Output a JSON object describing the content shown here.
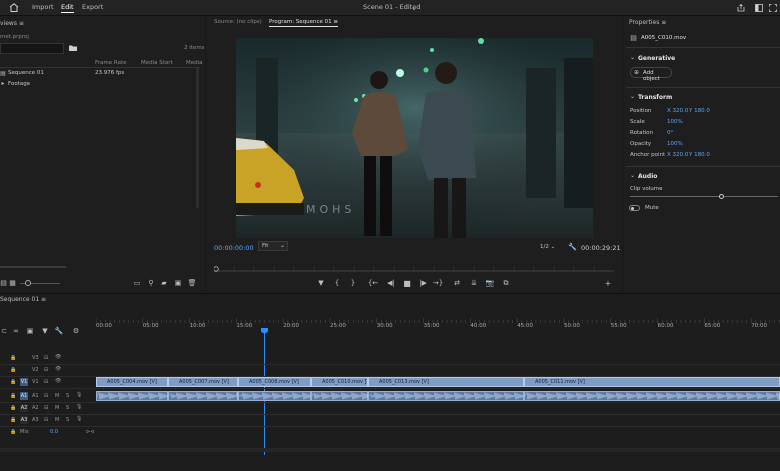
{
  "menu": {
    "import": "Import",
    "edit": "Edit",
    "export": "Export"
  },
  "title": "Scene 01 - Edited",
  "project": {
    "tab": "views",
    "filename": "met.prproj",
    "items_count": "2 items",
    "columns": [
      "Name",
      "Frame Rate",
      "Media Start",
      "Media"
    ],
    "rows": [
      {
        "name": "Sequence 01",
        "frame_rate": "23.976 fps"
      },
      {
        "name": "Footage",
        "frame_rate": ""
      }
    ]
  },
  "monitor": {
    "source_tab": "Source: (no clips)",
    "program_tab": "Program: Sequence 01",
    "timecode_in": "00:00:00:00",
    "fit": "Fit",
    "resolution": "1/2",
    "timecode_out": "00:00:29:21",
    "overlay_text": "MOHS"
  },
  "properties": {
    "title": "Properties",
    "clip_name": "A005_C010.mov",
    "generative": "Generative",
    "add_object": "Add object",
    "transform": "Transform",
    "position_label": "Position",
    "position_x": "X 320.0",
    "position_y": "Y 180.0",
    "scale_label": "Scale",
    "scale_value": "100%",
    "rotation_label": "Rotation",
    "rotation_value": "0°",
    "opacity_label": "Opacity",
    "opacity_value": "100%",
    "anchor_label": "Anchor point",
    "anchor_x": "X 320.0",
    "anchor_y": "Y 180.0",
    "audio": "Audio",
    "clip_volume": "Clip volume",
    "mute": "Mute"
  },
  "timeline": {
    "tab": "Sequence 01",
    "ruler": [
      "00:00",
      "05:00",
      "10:00",
      "15:00",
      "20:00",
      "25:00",
      "30:00",
      "35:00",
      "40:00",
      "45:00",
      "50:00",
      "55:00",
      "60:00",
      "65:00",
      "70:00"
    ],
    "video_tracks": [
      "V3",
      "V2",
      "V1"
    ],
    "audio_tracks": [
      "A1",
      "A2",
      "A3"
    ],
    "mix_label": "Mix",
    "mix_value": "0.0",
    "clips": [
      "A005_C004.mov [V]",
      "A005_C007.mov [V]",
      "A005_C008.mov [V]",
      "A005_C010.mov [V]",
      "A005_C013.mov [V]",
      "A005_C011.mov [V]"
    ]
  }
}
